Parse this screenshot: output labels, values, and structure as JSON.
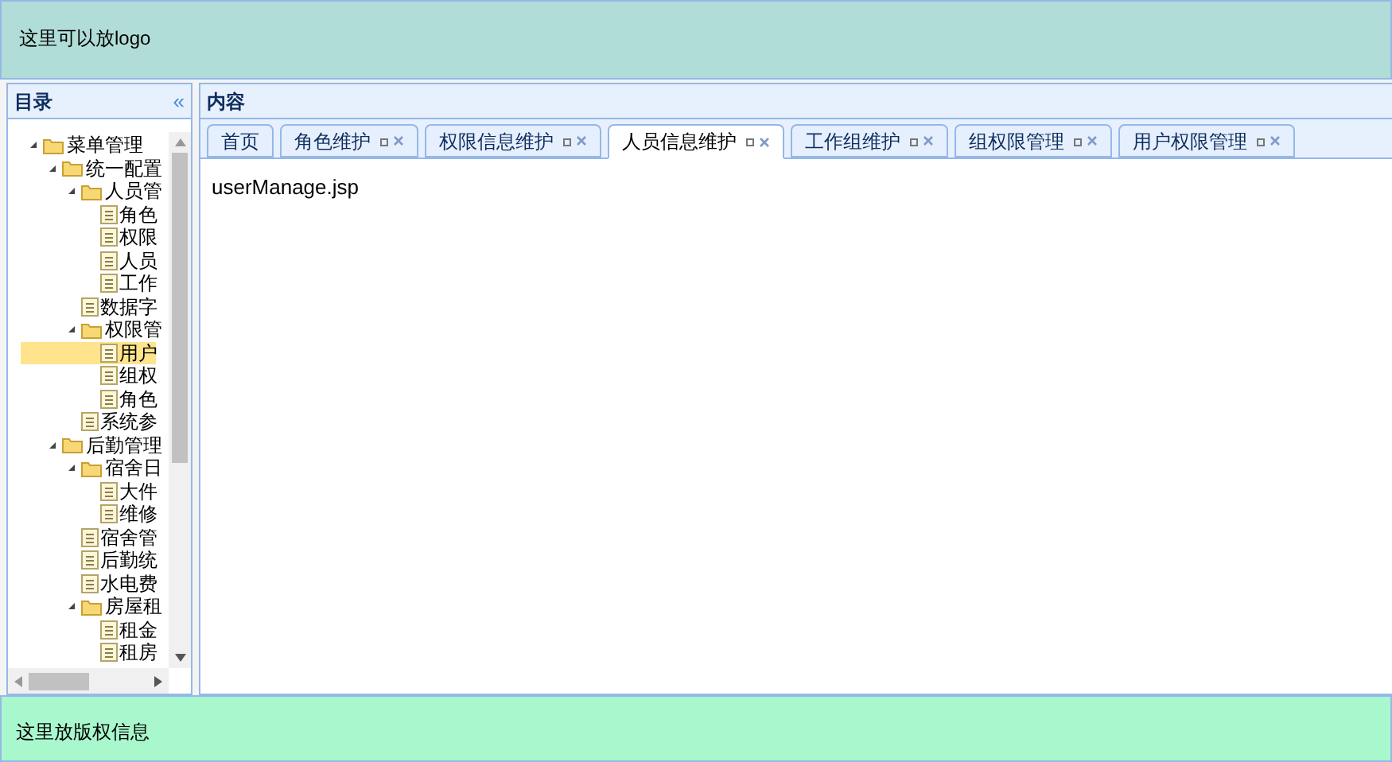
{
  "header": {
    "text": "这里可以放logo"
  },
  "sidebar": {
    "title": "目录",
    "collapse": "«",
    "tree": [
      {
        "label": "菜单管理",
        "expanded": true,
        "selected": false,
        "children": [
          {
            "label": "统一配置",
            "expanded": true,
            "selected": false,
            "children": [
              {
                "label": "人员管",
                "expanded": true,
                "selected": false,
                "children": [
                  {
                    "label": "角色",
                    "selected": false
                  },
                  {
                    "label": "权限",
                    "selected": false
                  },
                  {
                    "label": "人员",
                    "selected": false
                  },
                  {
                    "label": "工作",
                    "selected": false
                  }
                ]
              },
              {
                "label": "数据字",
                "selected": false
              },
              {
                "label": "权限管",
                "expanded": true,
                "selected": false,
                "children": [
                  {
                    "label": "用户",
                    "selected": true
                  },
                  {
                    "label": "组权",
                    "selected": false
                  },
                  {
                    "label": "角色",
                    "selected": false
                  }
                ]
              },
              {
                "label": "系统参",
                "selected": false
              }
            ]
          },
          {
            "label": "后勤管理",
            "expanded": true,
            "selected": false,
            "children": [
              {
                "label": "宿舍日",
                "expanded": true,
                "selected": false,
                "children": [
                  {
                    "label": "大件",
                    "selected": false
                  },
                  {
                    "label": "维修",
                    "selected": false
                  }
                ]
              },
              {
                "label": "宿舍管",
                "selected": false
              },
              {
                "label": "后勤统",
                "selected": false
              },
              {
                "label": "水电费",
                "selected": false
              },
              {
                "label": "房屋租",
                "expanded": true,
                "selected": false,
                "children": [
                  {
                    "label": "租金",
                    "selected": false
                  },
                  {
                    "label": "租房",
                    "selected": false
                  }
                ]
              }
            ]
          }
        ]
      }
    ]
  },
  "content": {
    "title": "内容",
    "tabs": [
      {
        "label": "首页",
        "closable": false,
        "selected": false
      },
      {
        "label": "角色维护",
        "closable": true,
        "selected": false
      },
      {
        "label": "权限信息维护",
        "closable": true,
        "selected": false
      },
      {
        "label": "人员信息维护",
        "closable": true,
        "selected": true
      },
      {
        "label": "工作组维护",
        "closable": true,
        "selected": false
      },
      {
        "label": "组权限管理",
        "closable": true,
        "selected": false
      },
      {
        "label": "用户权限管理",
        "closable": true,
        "selected": false
      }
    ],
    "body": "userManage.jsp"
  },
  "footer": {
    "text": "这里放版权信息"
  }
}
